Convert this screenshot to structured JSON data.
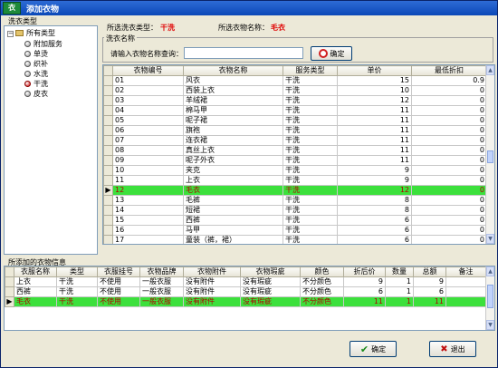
{
  "window": {
    "title": "添加衣物",
    "app_icon": "衣"
  },
  "tree": {
    "caption": "洗衣类型",
    "root": "所有类型",
    "items": [
      "附加服务",
      "单烫",
      "织补",
      "水洗",
      "干洗",
      "皮衣"
    ],
    "selected_index": 4
  },
  "info": {
    "type_label": "所选洗衣类型：",
    "type_value": "干洗",
    "name_label": "所选衣物名称：",
    "name_value": "毛衣"
  },
  "search": {
    "caption": "洗衣名称",
    "label": "请输入衣物名称查询：",
    "value": "",
    "button": "确定"
  },
  "clothes_table": {
    "columns": [
      "衣物编号",
      "衣物名称",
      "服务类型",
      "单价",
      "最低折扣"
    ],
    "rows": [
      [
        "01",
        "风衣",
        "干洗",
        "15",
        "0.9"
      ],
      [
        "02",
        "西装上衣",
        "干洗",
        "10",
        "0"
      ],
      [
        "03",
        "羊绒裙",
        "干洗",
        "12",
        "0"
      ],
      [
        "04",
        "棉马甲",
        "干洗",
        "11",
        "0"
      ],
      [
        "05",
        "呢子裙",
        "干洗",
        "11",
        "0"
      ],
      [
        "06",
        "旗袍",
        "干洗",
        "11",
        "0"
      ],
      [
        "07",
        "连衣裙",
        "干洗",
        "11",
        "0"
      ],
      [
        "08",
        "真丝上衣",
        "干洗",
        "11",
        "0"
      ],
      [
        "09",
        "呢子外衣",
        "干洗",
        "11",
        "0"
      ],
      [
        "10",
        "夹克",
        "干洗",
        "9",
        "0"
      ],
      [
        "11",
        "上衣",
        "干洗",
        "9",
        "0"
      ],
      [
        "12",
        "毛衣",
        "干洗",
        "12",
        "0"
      ],
      [
        "13",
        "毛裤",
        "干洗",
        "8",
        "0"
      ],
      [
        "14",
        "短裙",
        "干洗",
        "8",
        "0"
      ],
      [
        "15",
        "西裤",
        "干洗",
        "6",
        "0"
      ],
      [
        "16",
        "马甲",
        "干洗",
        "6",
        "0"
      ],
      [
        "17",
        "童装（裤，裙）",
        "干洗",
        "6",
        "0"
      ]
    ],
    "selected_index": 11,
    "row_marker": "▶"
  },
  "added": {
    "caption": "所添加的衣物信息",
    "columns": [
      "衣服名称",
      "类型",
      "衣服挂号",
      "衣物品牌",
      "衣物附件",
      "衣物瑕疵",
      "颜色",
      "折后价",
      "数量",
      "总额",
      "备注"
    ],
    "rows": [
      [
        "上衣",
        "干洗",
        "不使用",
        "一般衣服",
        "没有附件",
        "没有瑕疵",
        "不分颜色",
        "9",
        "1",
        "9",
        ""
      ],
      [
        "西裤",
        "干洗",
        "不使用",
        "一般衣服",
        "没有附件",
        "没有瑕疵",
        "不分颜色",
        "6",
        "1",
        "6",
        ""
      ],
      [
        "毛衣",
        "干洗",
        "不使用",
        "一般衣服",
        "没有附件",
        "没有瑕疵",
        "不分颜色",
        "11",
        "1",
        "11",
        ""
      ]
    ],
    "selected_index": 2
  },
  "buttons": {
    "ok": "确定",
    "exit": "退出"
  },
  "colors": {
    "selection": "#3ce03c",
    "accent_red": "#e00000",
    "titlebar": "#0b48b7"
  }
}
